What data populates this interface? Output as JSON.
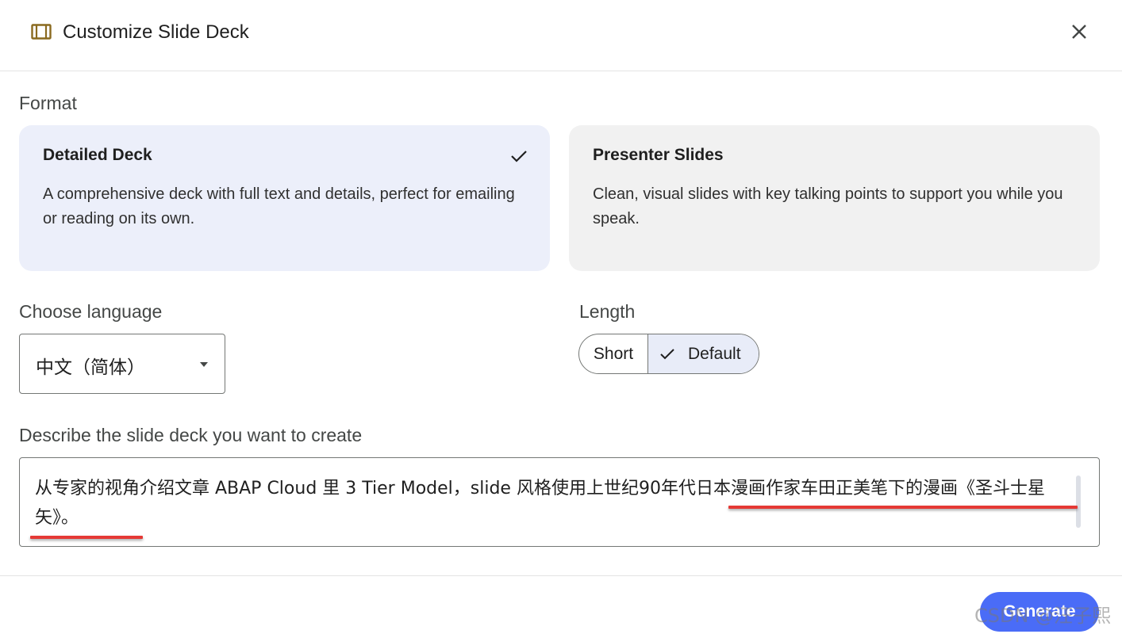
{
  "header": {
    "icon": "slide-deck-icon",
    "title": "Customize Slide Deck",
    "close_icon": "close-icon"
  },
  "format": {
    "label": "Format",
    "options": [
      {
        "title": "Detailed Deck",
        "description": "A comprehensive deck with full text and details, perfect for emailing or reading on its own.",
        "selected": true
      },
      {
        "title": "Presenter Slides",
        "description": "Clean, visual slides with key talking points to support you while you speak.",
        "selected": false
      }
    ]
  },
  "language": {
    "label": "Choose language",
    "selected": "中文（简体）"
  },
  "length": {
    "label": "Length",
    "options": [
      "Short",
      "Default"
    ],
    "selected": "Default"
  },
  "description": {
    "label": "Describe the slide deck you want to create",
    "value": "从专家的视角介绍文章 ABAP Cloud 里 3 Tier Model，slide 风格使用上世纪90年代日本漫画作家车田正美笔下的漫画《圣斗士星矢》。"
  },
  "footer": {
    "generate_label": "Generate"
  },
  "watermark": "CSDN @汪子熙",
  "colors": {
    "selected_card": "#eceffa",
    "unselected_card": "#f1f1f1",
    "primary_button": "#4a6cf7",
    "annotation_underline": "#e53935"
  }
}
